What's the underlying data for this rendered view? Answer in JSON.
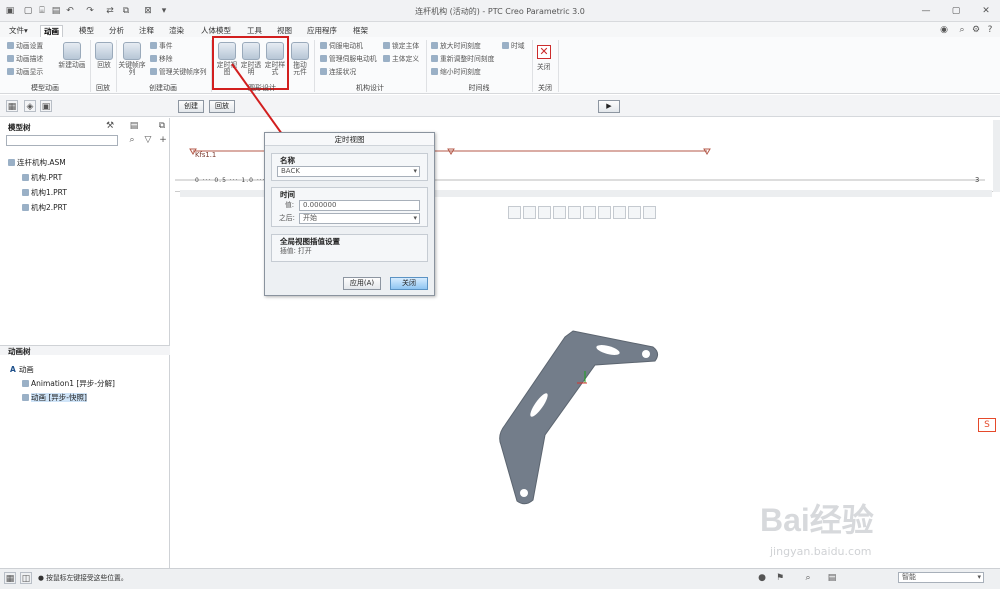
{
  "window": {
    "title": "连杆机构 (活动的) - PTC Creo Parametric 3.0"
  },
  "tabs": [
    "文件▾",
    "动画",
    "模型",
    "分析",
    "注释",
    "渲染",
    "人体模型",
    "工具",
    "视图",
    "应用程序",
    "框架"
  ],
  "ribbon": {
    "model_animation": {
      "items": [
        "动画设置",
        "动画描述",
        "动画显示"
      ],
      "label": "模型动画"
    },
    "new_animation": {
      "label": "新建动画"
    },
    "playback": {
      "buttons": [
        "回放"
      ],
      "label": "回放"
    },
    "create_animation": {
      "big": "关键帧序列",
      "items": [
        "事件",
        "移除",
        "管理关键帧序列"
      ],
      "label": "创建动画"
    },
    "graphic_design": {
      "buttons": [
        "定时视图",
        "定时透明",
        "定时样式"
      ],
      "extra": "拖动元件",
      "label": "图形设计"
    },
    "mechanism_design": {
      "items_left": [
        "伺服电动机",
        "管理伺服电动机",
        "连接状况"
      ],
      "items_right": [
        "锁定主体",
        "主体定义"
      ],
      "label": "机构设计"
    },
    "timeline": {
      "items": [
        "放大时间刻度",
        "重新调整时间刻度",
        "缩小时间刻度"
      ],
      "extra": "时域",
      "label": "时间线"
    },
    "close": {
      "button": "关闭",
      "label": "关闭"
    }
  },
  "subtoolbar": {
    "create": "创建",
    "playback": "回放"
  },
  "model_tree": {
    "title": "模型树",
    "root": "连杆机构.ASM",
    "children": [
      "机构.PRT",
      "机构1.PRT",
      "机构2.PRT"
    ]
  },
  "animation_tree": {
    "title": "动画树",
    "root": "动画",
    "items": [
      "Animation1 [异步-分解]",
      "动画 [异步-快照]"
    ]
  },
  "timeline": {
    "label": "Kfs1.1",
    "ruler": "0 ··· 0.5 ··· 1.0 ··· 1.5 ··· 2.0 ··· 2.5 ··· 3",
    "end": "3"
  },
  "dialog": {
    "title": "定时视图",
    "name_section": "名称",
    "name_value": "BACK",
    "time_section": "时间",
    "value_label": "值:",
    "value": "0.000000",
    "after_label": "之后:",
    "after_value": "开始",
    "global_section": "全局视图插值设置",
    "interp_label": "插值: 打开",
    "apply": "应用(A)",
    "close": "关闭"
  },
  "status": {
    "text": "● 按鼠标左键接受这些位置。",
    "filter": "智能"
  },
  "watermark": {
    "line1": "Bai经验",
    "line2": "jingyan.baidu.com"
  }
}
